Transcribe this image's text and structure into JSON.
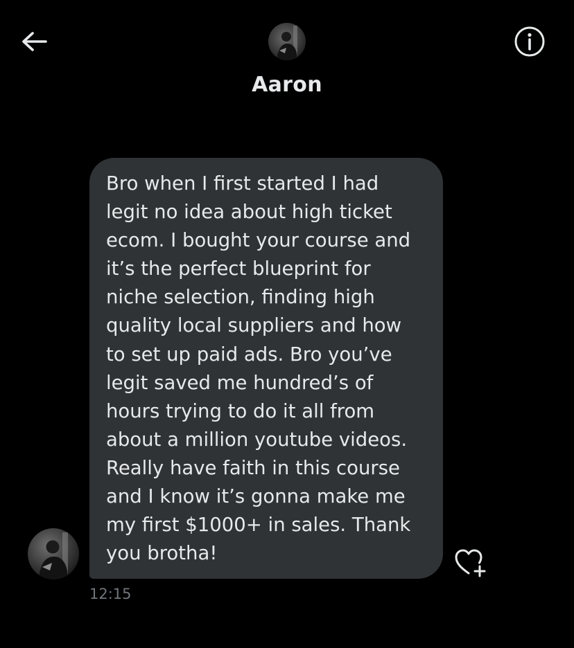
{
  "header": {
    "contact_name": "Aaron",
    "back_icon": "arrow-left-icon",
    "info_icon": "info-circle-icon"
  },
  "message": {
    "text": "Bro when I first started I had\nlegit no idea about high ticket\necom. I bought your course and\nit’s the perfect blueprint for\nniche selection, finding high\nquality local suppliers and how\nto set up paid ads. Bro you’ve\nlegit saved me hundred’s of\nhours trying to do it all from\nabout a million youtube videos.\nReally have faith in this course\nand I know it’s gonna make me\nmy first $1000+ in sales. Thank\nyou brotha!",
    "timestamp": "12:15",
    "react_icon": "heart-plus-icon"
  },
  "colors": {
    "background": "#000000",
    "bubble": "#2f3336",
    "text": "#e7e9ea",
    "muted": "#71767b"
  }
}
